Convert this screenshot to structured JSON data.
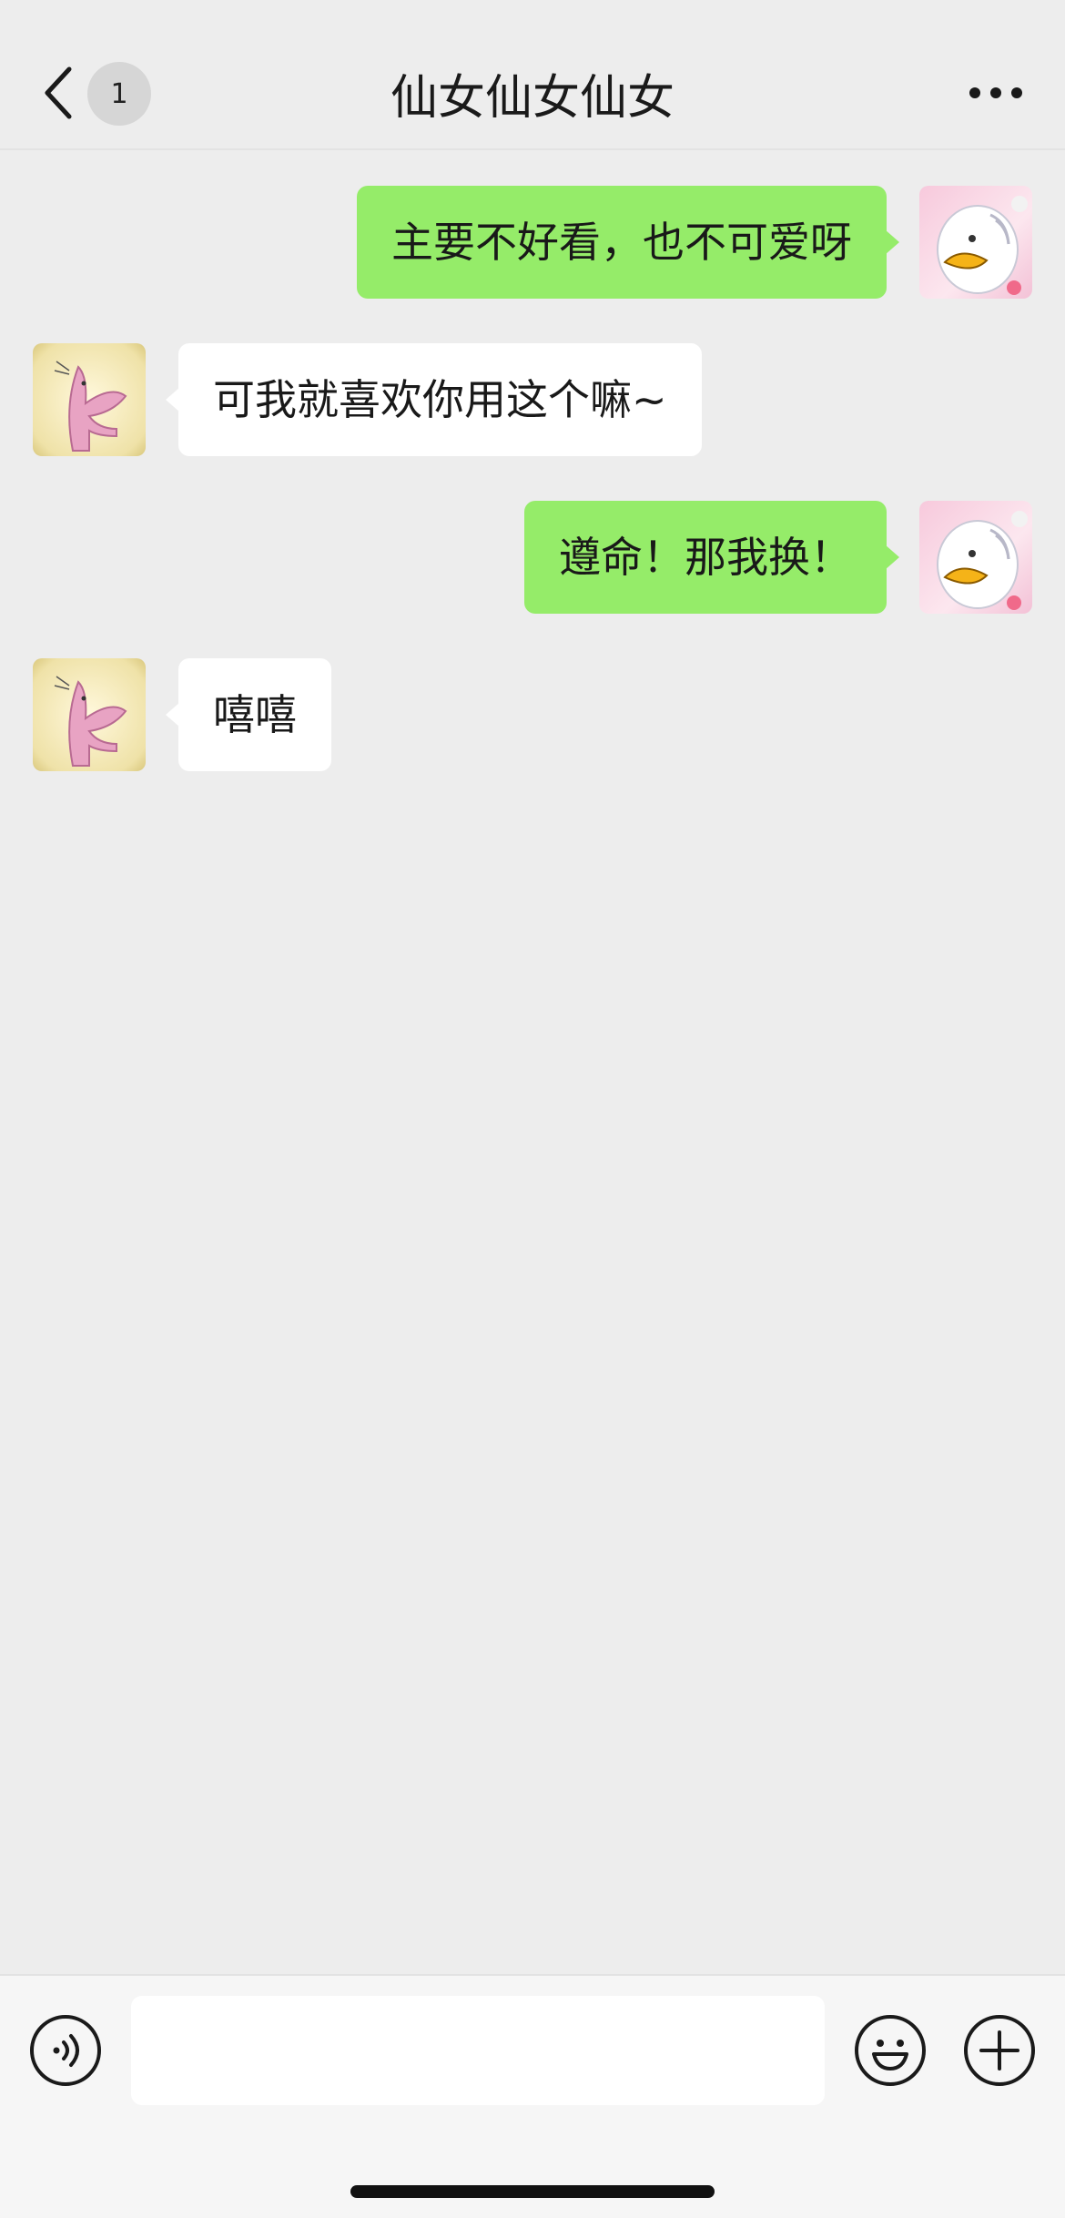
{
  "header": {
    "back_icon": "chevron-left-icon",
    "unread_badge": "1",
    "title": "仙女仙女仙女",
    "more_icon": "ellipsis-icon"
  },
  "messages": [
    {
      "sender": "me",
      "text": "主要不好看，也不可爱呀"
    },
    {
      "sender": "them",
      "text": "可我就喜欢你用这个嘛~"
    },
    {
      "sender": "me",
      "text": "遵命！那我换！"
    },
    {
      "sender": "them",
      "text": "嘻嘻"
    }
  ],
  "input_bar": {
    "voice_icon": "voice-icon",
    "text_value": "",
    "emoji_icon": "emoji-icon",
    "plus_icon": "plus-icon"
  },
  "colors": {
    "background": "#ededed",
    "bubble_me": "#95ec69",
    "bubble_them": "#ffffff"
  }
}
